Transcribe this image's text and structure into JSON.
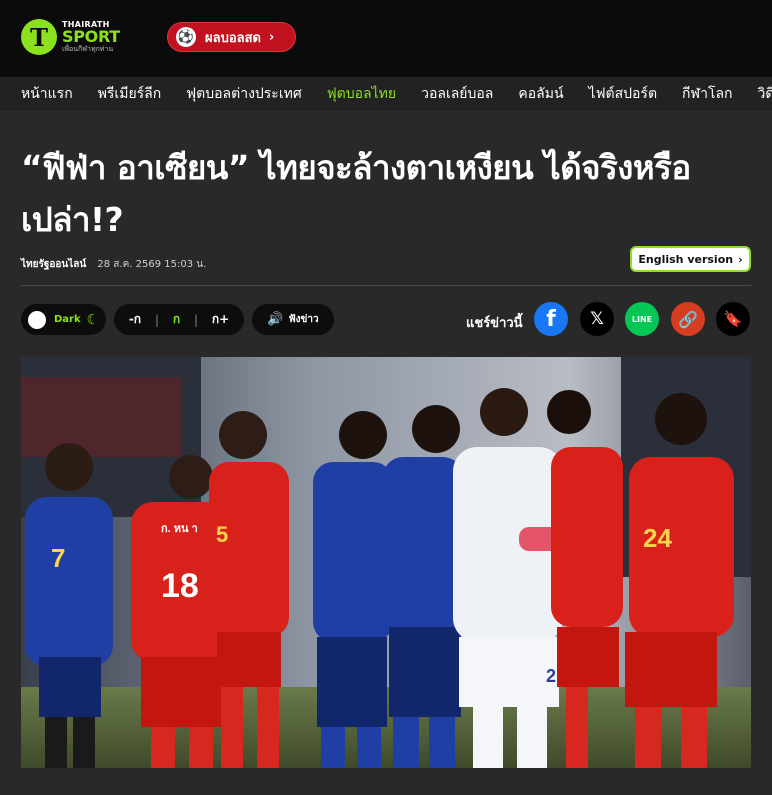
{
  "brand": {
    "small": "THAIRATH",
    "big": "SPORT",
    "tagline": "เพื่อนกีฬาทุกท่าน"
  },
  "header": {
    "live_button_label": "ผลบอลสด"
  },
  "nav": {
    "items": [
      {
        "label": "หน้าแรก",
        "active": false
      },
      {
        "label": "พรีเมียร์ลีก",
        "active": false
      },
      {
        "label": "ฟุตบอลต่างประเทศ",
        "active": false
      },
      {
        "label": "ฟุตบอลไทย",
        "active": true
      },
      {
        "label": "วอลเลย์บอล",
        "active": false
      },
      {
        "label": "คอลัมน์",
        "active": false
      },
      {
        "label": "ไฟต์สปอร์ต",
        "active": false
      },
      {
        "label": "กีฬาโลก",
        "active": false
      },
      {
        "label": "วิดีโ",
        "active": false
      }
    ]
  },
  "article": {
    "title": "“ฟีฟ่า อาเซียน” ไทยจะล้างตาเหงียน ได้จริงหรือเปล่า!?",
    "source": "ไทยรัฐออนไลน์",
    "date": "28 ส.ค. 2569 15:03 น.",
    "english_version_label": "English version"
  },
  "toolbar": {
    "dark_label": "Dark",
    "font_smaller": "-ก",
    "font_normal": "ก",
    "font_larger": "ก+",
    "listen_label": "ฟังข่าว",
    "share_label": "แชร์ข่าวนี้"
  },
  "share": {
    "line_label": "LINE"
  },
  "colors": {
    "accent": "#8be11d",
    "live": "#c1121f",
    "facebook": "#1877f2",
    "line": "#06c755",
    "link": "#d63c20"
  },
  "photo": {
    "jersey_numbers": [
      "7",
      "18",
      "5",
      "24",
      "2"
    ],
    "jersey_name": "ก. หน า"
  }
}
